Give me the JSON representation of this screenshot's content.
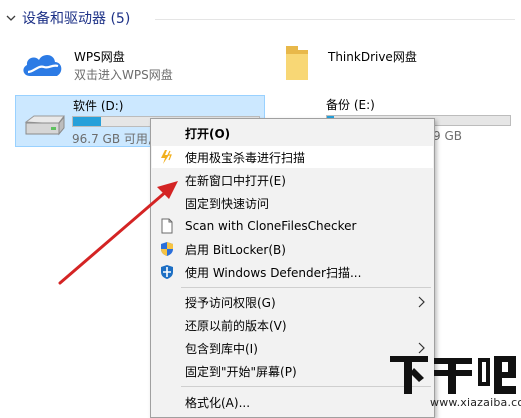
{
  "group": {
    "title": "设备和驱动器 (5)"
  },
  "items": {
    "wps": {
      "name": "WPS网盘",
      "sub": "双击进入WPS网盘"
    },
    "thinkdrive": {
      "name": "ThinkDrive网盘"
    },
    "drive_d": {
      "name": "软件 (D:)",
      "free": "96.7 GB 可用,",
      "used_fraction": 0.15
    },
    "drive_e": {
      "name": "备份 (E:)",
      "free": "9 GB",
      "used_fraction": 0.04
    }
  },
  "context_menu": {
    "items": [
      {
        "label": "打开(O)",
        "icon": "none",
        "bold": true
      },
      {
        "label": "使用极宝杀毒进行扫描",
        "icon": "lightning-icon",
        "highlight": true
      },
      {
        "label": "在新窗口中打开(E)",
        "icon": "none"
      },
      {
        "label": "固定到快速访问",
        "icon": "none"
      },
      {
        "label": "Scan with CloneFilesChecker",
        "icon": "document-icon"
      },
      {
        "label": "启用 BitLocker(B)",
        "icon": "shield-icon"
      },
      {
        "label": "使用 Windows Defender扫描...",
        "icon": "defender-icon"
      },
      {
        "label": "授予访问权限(G)",
        "icon": "none",
        "submenu": true
      },
      {
        "label": "还原以前的版本(V)",
        "icon": "none"
      },
      {
        "label": "包含到库中(I)",
        "icon": "none",
        "submenu": true
      },
      {
        "label": "固定到\"开始\"屏幕(P)",
        "icon": "none"
      },
      {
        "label": "格式化(A)...",
        "icon": "none"
      }
    ]
  },
  "watermark": {
    "logo": "下载吧",
    "url": "www.xiazaiba.com"
  },
  "colors": {
    "accent": "#26a0da",
    "selection": "#cce8ff",
    "arrow": "#d42424"
  }
}
